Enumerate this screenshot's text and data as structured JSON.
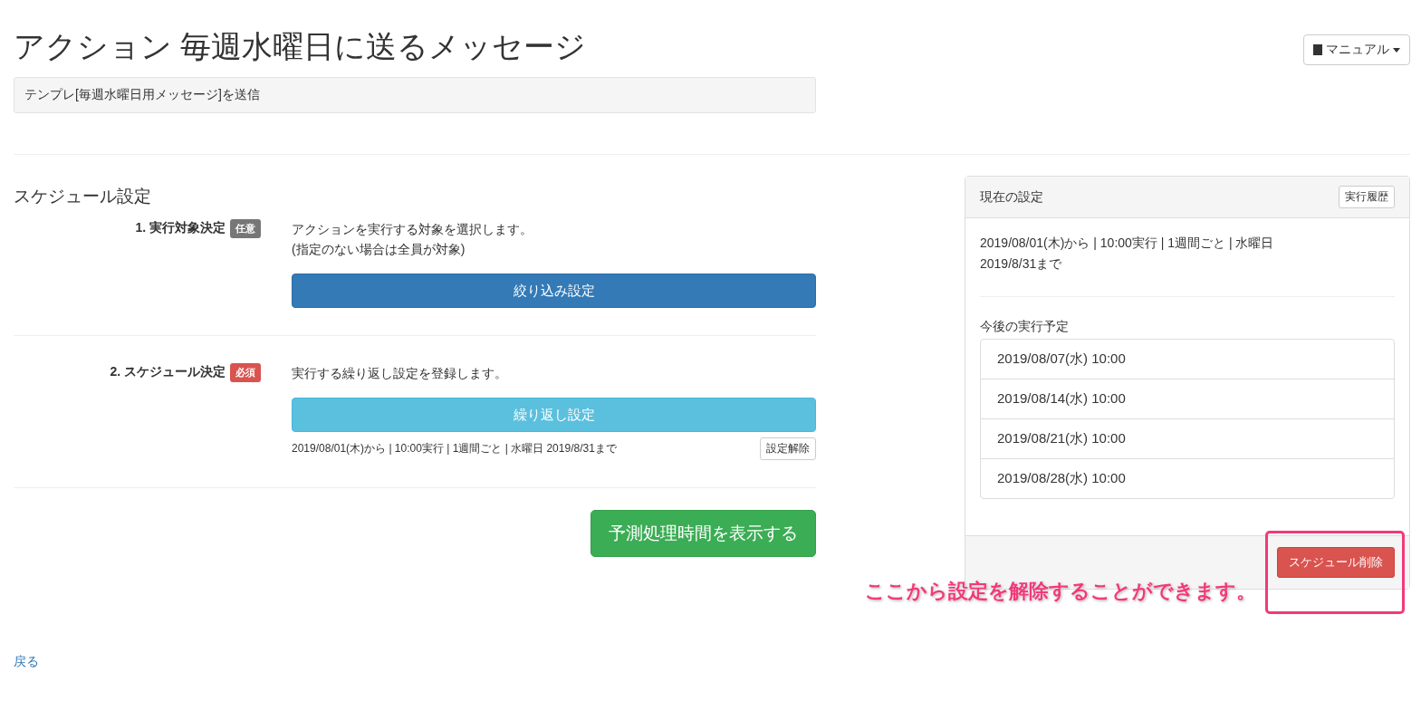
{
  "header": {
    "title": "アクション 毎週水曜日に送るメッセージ",
    "manual_button": "マニュアル",
    "description": "テンプレ[毎週水曜日用メッセージ]を送信"
  },
  "schedule": {
    "title": "スケジュール設定",
    "steps": [
      {
        "label": "1. 実行対象決定",
        "badge": {
          "text": "任意",
          "kind": "optional"
        },
        "description_lines": [
          "アクションを実行する対象を選択します。",
          "(指定のない場合は全員が対象)"
        ],
        "button": {
          "label": "絞り込み設定",
          "kind": "primary"
        }
      },
      {
        "label": "2. スケジュール決定",
        "badge": {
          "text": "必須",
          "kind": "required"
        },
        "description_lines": [
          "実行する繰り返し設定を登録します。"
        ],
        "button": {
          "label": "繰り返し設定",
          "kind": "info"
        },
        "summary": "2019/08/01(木)から | 10:00実行 | 1週間ごと | 水曜日 2019/8/31まで",
        "clear_button": "設定解除"
      }
    ],
    "estimate_button": "予測処理時間を表示する"
  },
  "current_settings": {
    "title": "現在の設定",
    "history_button": "実行履歴",
    "summary_lines": [
      "2019/08/01(木)から | 10:00実行 | 1週間ごと | 水曜日",
      "2019/8/31まで"
    ],
    "upcoming_label": "今後の実行予定",
    "upcoming": [
      "2019/08/07(水) 10:00",
      "2019/08/14(水) 10:00",
      "2019/08/21(水) 10:00",
      "2019/08/28(水) 10:00"
    ],
    "delete_button": "スケジュール削除"
  },
  "annotation": {
    "text": "ここから設定を解除することができます。"
  },
  "back_link": "戻る"
}
